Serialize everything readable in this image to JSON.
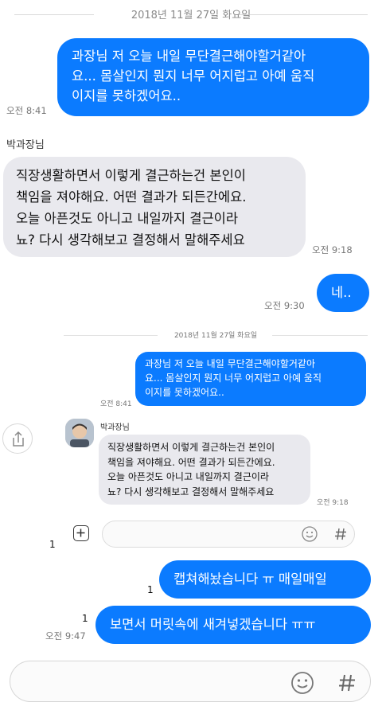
{
  "date_header": "2018년 11월 27일 화요일",
  "messages": {
    "m1": {
      "lines": [
        "과장님 저 오늘 내일 무단결근해야할거같아",
        "요... 몸살인지 뭔지 너무 어지럽고 아예 움직",
        "이지를 못하겠어요.."
      ],
      "time": "오전 8:41"
    },
    "sender": "박과장님",
    "m2": {
      "lines": [
        "직장생활하면서 이렇게 결근하는건 본인이",
        "책임을 져야해요. 어떤 결과가 되든간에요.",
        "오늘 아픈것도 아니고 내일까지 결근이라",
        "뇨? 다시 생각해보고 결정해서 말해주세요"
      ],
      "time": "오전 9:18"
    },
    "m3": {
      "text": "네..",
      "time": "오전 9:30"
    },
    "m4": {
      "text": "캡쳐해놨습니다 ㅠ 매일매일",
      "unread": "1"
    },
    "m5": {
      "text": "보면서 머릿속에 새겨넣겠습니다 ㅠㅠ",
      "unread": "1",
      "time": "오전 9:47"
    }
  },
  "inner": {
    "date_header": "2018년 11월 27일 화요일",
    "m1": {
      "lines": [
        "과장님 저 오늘 내일 무단결근해야할거같아",
        "요... 몸살인지 뭔지 너무 어지럽고 아예 움직",
        "이지를 못하겠어요.."
      ],
      "time": "오전 8:41"
    },
    "sender": "박과장님",
    "m2": {
      "lines": [
        "직장생활하면서 이렇게 결근하는건 본인이",
        "책임을 져야해요. 어떤 결과가 되든간에요.",
        "오늘 아픈것도 아니고 내일까지 결근이라",
        "뇨? 다시 생각해보고 결정해서 말해주세요"
      ],
      "time": "오전 9:18"
    },
    "count": "1"
  },
  "colors": {
    "bubble_out": "#0b7bff",
    "bubble_in": "#e9e9ee"
  },
  "icons": [
    "share-icon",
    "plus-icon",
    "emoji-icon",
    "hash-icon",
    "avatar"
  ]
}
